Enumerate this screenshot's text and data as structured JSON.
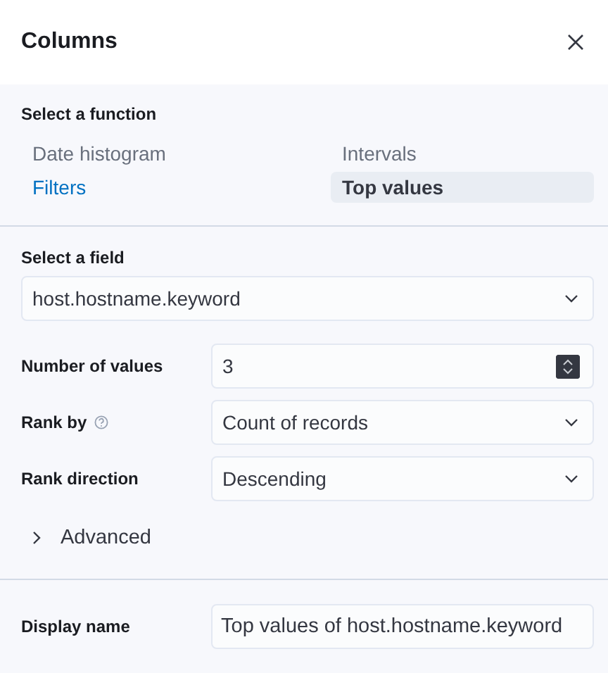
{
  "flyout": {
    "title": "Columns"
  },
  "function_section": {
    "label": "Select a function",
    "functions": [
      {
        "label": "Date histogram",
        "disabled": true,
        "selected": false
      },
      {
        "label": "Intervals",
        "disabled": true,
        "selected": false
      },
      {
        "label": "Filters",
        "disabled": false,
        "selected": false
      },
      {
        "label": "Top values",
        "disabled": false,
        "selected": true
      }
    ]
  },
  "field_section": {
    "label": "Select a field",
    "value": "host.hostname.keyword"
  },
  "settings": [
    {
      "kind": "number",
      "label": "Number of values",
      "value": "3",
      "help": false
    },
    {
      "kind": "select",
      "label": "Rank by",
      "value": "Count of records",
      "help": true
    },
    {
      "kind": "select",
      "label": "Rank direction",
      "value": "Descending",
      "help": false
    }
  ],
  "advanced": {
    "label": "Advanced",
    "expanded": false
  },
  "display_name": {
    "label": "Display name",
    "value": "Top values of host.hostname.keyword"
  }
}
